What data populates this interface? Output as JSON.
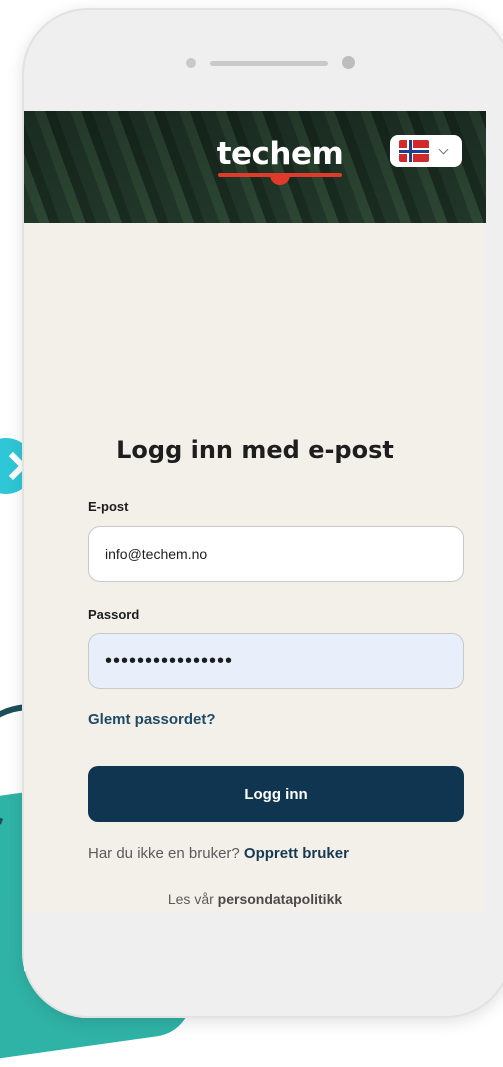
{
  "header": {
    "logo_text": "techem",
    "language": {
      "selected": "Norwegian (flag)",
      "icon": "flag-norway-icon"
    }
  },
  "login": {
    "title": "Logg inn med e-post",
    "email_label": "E-post",
    "email_value": "info@techem.no",
    "password_label": "Passord",
    "password_value": "••••••••••••••••",
    "forgot_link": "Glemt passordet?",
    "submit_label": "Logg inn",
    "signup_prompt": "Har du ikke en bruker?",
    "signup_link": "Opprett bruker",
    "privacy_prefix": "Les vår",
    "privacy_link": "persondatapolitikk"
  },
  "colors": {
    "primary": "#0f3550",
    "link": "#1f4b66",
    "screen_bg": "#f3f0e9",
    "accent_teal": "#2fc7d7",
    "logo_red": "#e23a2a"
  }
}
